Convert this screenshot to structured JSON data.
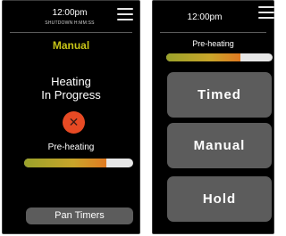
{
  "left_screen": {
    "time": "12:00pm",
    "shutdown_text": "SHUTDOWN H:MM:SS",
    "mode_title": "Manual",
    "status_line1": "Heating",
    "status_line2": "In Progress",
    "cancel_icon": "close-icon",
    "progress_label": "Pre-heating",
    "progress_value": 0.75,
    "pan_timers_button": "Pan Timers"
  },
  "right_screen": {
    "time": "12:00pm",
    "progress_label": "Pre-heating",
    "progress_value": 0.7,
    "buttons": [
      "Timed",
      "Manual",
      "Hold"
    ]
  },
  "colors": {
    "accent_yellow": "#c7c418",
    "cancel_red": "#e74a24",
    "button_gray": "#5c5c5c",
    "screen_bg": "#000000"
  }
}
